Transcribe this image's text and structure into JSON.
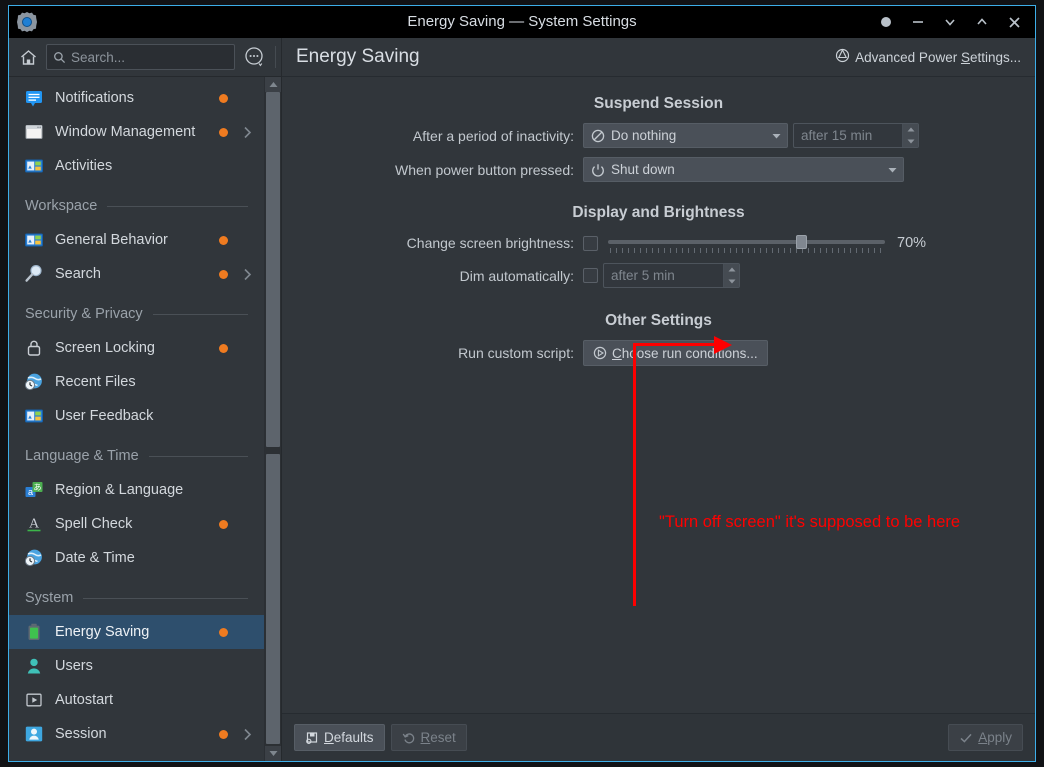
{
  "window": {
    "title": "Energy Saving — System Settings",
    "app_icon": "system-settings-gear-icon",
    "controls": [
      {
        "name": "keep-above-button",
        "glyph": "dot"
      },
      {
        "name": "minimize-button",
        "glyph": "minus"
      },
      {
        "name": "shade-down-button",
        "glyph": "chevron-down"
      },
      {
        "name": "shade-up-button",
        "glyph": "chevron-up"
      },
      {
        "name": "close-button",
        "glyph": "x"
      }
    ]
  },
  "sidebar": {
    "home_icon": "home-icon",
    "search": {
      "icon": "search-icon",
      "placeholder": "Search...",
      "value": ""
    },
    "menu_icon": "hamburger-menu-icon",
    "items": [
      {
        "label": "Notifications",
        "icon": "notifications-icon",
        "dot": true,
        "chevron": false,
        "selected": false,
        "type": "item"
      },
      {
        "label": "Window Management",
        "icon": "window-icon",
        "dot": true,
        "chevron": true,
        "selected": false,
        "type": "item"
      },
      {
        "label": "Activities",
        "icon": "activities-icon",
        "dot": false,
        "chevron": false,
        "selected": false,
        "type": "item"
      },
      {
        "label": "Workspace",
        "type": "header"
      },
      {
        "label": "General Behavior",
        "icon": "general-behavior-icon",
        "dot": true,
        "chevron": false,
        "selected": false,
        "type": "item"
      },
      {
        "label": "Search",
        "icon": "magnifier-icon",
        "dot": true,
        "chevron": true,
        "selected": false,
        "type": "item"
      },
      {
        "label": "Security & Privacy",
        "type": "header"
      },
      {
        "label": "Screen Locking",
        "icon": "lock-icon",
        "dot": true,
        "chevron": false,
        "selected": false,
        "type": "item"
      },
      {
        "label": "Recent Files",
        "icon": "clock-globe-icon",
        "dot": false,
        "chevron": false,
        "selected": false,
        "type": "item"
      },
      {
        "label": "User Feedback",
        "icon": "user-feedback-icon",
        "dot": false,
        "chevron": false,
        "selected": false,
        "type": "item"
      },
      {
        "label": "Language & Time",
        "type": "header"
      },
      {
        "label": "Region & Language",
        "icon": "region-language-icon",
        "dot": false,
        "chevron": false,
        "selected": false,
        "type": "item"
      },
      {
        "label": "Spell Check",
        "icon": "spell-check-icon",
        "dot": true,
        "chevron": false,
        "selected": false,
        "type": "item"
      },
      {
        "label": "Date & Time",
        "icon": "clock-globe-icon",
        "dot": false,
        "chevron": false,
        "selected": false,
        "type": "item"
      },
      {
        "label": "System",
        "type": "header"
      },
      {
        "label": "Energy Saving",
        "icon": "battery-icon",
        "dot": true,
        "chevron": false,
        "selected": true,
        "type": "item"
      },
      {
        "label": "Users",
        "icon": "user-icon",
        "dot": false,
        "chevron": false,
        "selected": false,
        "type": "item"
      },
      {
        "label": "Autostart",
        "icon": "autostart-icon",
        "dot": false,
        "chevron": false,
        "selected": false,
        "type": "item"
      },
      {
        "label": "Session",
        "icon": "session-icon",
        "dot": true,
        "chevron": true,
        "selected": false,
        "type": "item"
      }
    ],
    "scrollbar": {
      "up_arrow": "scroll-up-arrow",
      "down_arrow": "scroll-down-arrow"
    }
  },
  "main": {
    "page_title": "Energy Saving",
    "advanced_link": {
      "icon": "power-settings-icon",
      "text_before": "Advanced Power ",
      "accel": "S",
      "text_after": "ettings..."
    },
    "sections": {
      "suspend": {
        "title": "Suspend Session",
        "inactivity": {
          "label": "After a period of inactivity:",
          "combo_value": "Do nothing",
          "combo_icon": "no-entry-icon",
          "spin_value": "after 15 min",
          "spin_enabled": false
        },
        "power_button": {
          "label": "When power button pressed:",
          "combo_value": "Shut down",
          "combo_icon": "power-icon"
        }
      },
      "display": {
        "title": "Display and Brightness",
        "brightness": {
          "label": "Change screen brightness:",
          "checked": false,
          "value_percent": 70,
          "value_text": "70%"
        },
        "dim": {
          "label": "Dim automatically:",
          "checked": false,
          "spin_value": "after 5 min",
          "spin_enabled": false
        }
      },
      "other": {
        "title": "Other Settings",
        "script": {
          "label": "Run custom script:",
          "button_icon": "run-conditions-icon",
          "button_accel": "C",
          "button_text": "hoose run conditions..."
        }
      }
    },
    "annotation": {
      "text": "\"Turn off screen\" it's supposed to be here",
      "color": "#fe0000"
    },
    "footer": {
      "defaults": {
        "icon": "defaults-icon",
        "accel": "D",
        "text": "efaults",
        "enabled": true
      },
      "reset": {
        "icon": "undo-icon",
        "accel": "R",
        "text": "eset",
        "enabled": false
      },
      "apply": {
        "icon": "check-icon",
        "accel": "A",
        "text": "pply",
        "enabled": false
      }
    }
  },
  "colors": {
    "accent_border": "#3daee9",
    "selection": "#2e4f6d",
    "modified_dot": "#ef7b20",
    "annotation": "#fe0000",
    "window_bg": "#31363b"
  }
}
